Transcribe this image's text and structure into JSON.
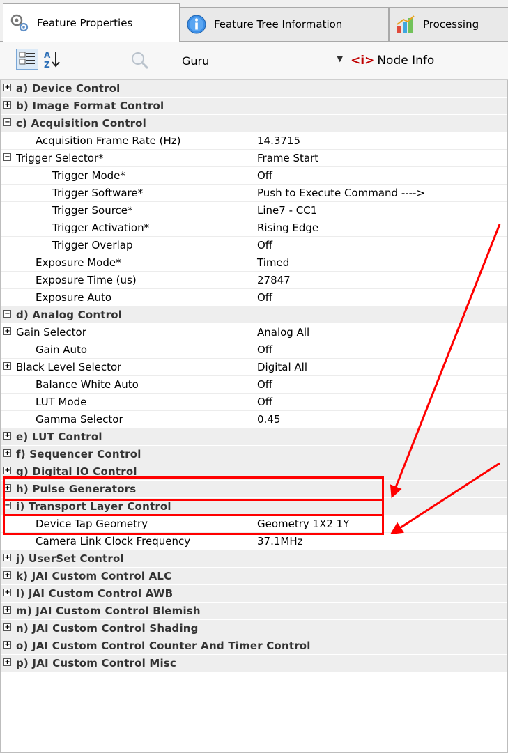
{
  "tabs": [
    {
      "label": "Feature Properties",
      "icon": "gear-icon",
      "active": true
    },
    {
      "label": "Feature Tree Information",
      "icon": "info-icon",
      "active": false
    },
    {
      "label": "Processing",
      "icon": "chart-icon",
      "active": false
    }
  ],
  "toolbar": {
    "visibility": "Guru",
    "node_info": "Node Info",
    "node_info_icon": "<i>"
  },
  "rows": [
    {
      "kind": "cat",
      "toggle": "+",
      "name": "a) Device Control",
      "level": 0
    },
    {
      "kind": "cat",
      "toggle": "+",
      "name": "b) Image Format Control",
      "level": 0
    },
    {
      "kind": "cat",
      "toggle": "-",
      "name": "c) Acquisition Control",
      "level": 0
    },
    {
      "kind": "prop",
      "name": "Acquisition Frame Rate (Hz)",
      "value": "14.3715",
      "level": 1
    },
    {
      "kind": "prop",
      "toggle": "-",
      "name": "Trigger Selector*",
      "value": "Frame Start",
      "level": 0
    },
    {
      "kind": "prop",
      "name": "Trigger Mode*",
      "value": "Off",
      "level": 2
    },
    {
      "kind": "prop",
      "name": "Trigger Software*",
      "value": "Push to Execute Command ---->",
      "level": 2
    },
    {
      "kind": "prop",
      "name": "Trigger Source*",
      "value": "Line7 - CC1",
      "level": 2
    },
    {
      "kind": "prop",
      "name": "Trigger Activation*",
      "value": "Rising Edge",
      "level": 2
    },
    {
      "kind": "prop",
      "name": "Trigger Overlap",
      "value": "Off",
      "level": 2
    },
    {
      "kind": "prop",
      "name": "Exposure Mode*",
      "value": "Timed",
      "level": 1
    },
    {
      "kind": "prop",
      "name": "Exposure Time (us)",
      "value": "27847",
      "level": 1
    },
    {
      "kind": "prop",
      "name": "Exposure Auto",
      "value": "Off",
      "level": 1
    },
    {
      "kind": "cat",
      "toggle": "-",
      "name": "d) Analog Control",
      "level": 0
    },
    {
      "kind": "prop",
      "toggle": "+",
      "name": "Gain Selector",
      "value": "Analog All",
      "level": 0
    },
    {
      "kind": "prop",
      "name": "Gain Auto",
      "value": "Off",
      "level": 1
    },
    {
      "kind": "prop",
      "toggle": "+",
      "name": "Black Level Selector",
      "value": "Digital All",
      "level": 0
    },
    {
      "kind": "prop",
      "name": "Balance White Auto",
      "value": "Off",
      "level": 1
    },
    {
      "kind": "prop",
      "name": "LUT Mode",
      "value": "Off",
      "level": 1
    },
    {
      "kind": "prop",
      "name": "Gamma Selector",
      "value": "0.45",
      "level": 1
    },
    {
      "kind": "cat",
      "toggle": "+",
      "name": "e) LUT Control",
      "level": 0
    },
    {
      "kind": "cat",
      "toggle": "+",
      "name": "f) Sequencer Control",
      "level": 0
    },
    {
      "kind": "cat",
      "toggle": "+",
      "name": "g) Digital IO Control",
      "level": 0
    },
    {
      "kind": "cat",
      "toggle": "+",
      "name": "h) Pulse Generators",
      "level": 0
    },
    {
      "kind": "cat",
      "toggle": "-",
      "name": "i) Transport Layer Control",
      "level": 0
    },
    {
      "kind": "prop",
      "name": "Device Tap Geometry",
      "value": "Geometry 1X2 1Y",
      "level": 1
    },
    {
      "kind": "prop",
      "name": "Camera Link Clock Frequency",
      "value": "37.1MHz",
      "level": 1
    },
    {
      "kind": "cat",
      "toggle": "+",
      "name": "j) UserSet Control",
      "level": 0
    },
    {
      "kind": "cat",
      "toggle": "+",
      "name": "k) JAI Custom Control ALC",
      "level": 0
    },
    {
      "kind": "cat",
      "toggle": "+",
      "name": "l) JAI Custom Control AWB",
      "level": 0
    },
    {
      "kind": "cat",
      "toggle": "+",
      "name": "m) JAI Custom Control Blemish",
      "level": 0
    },
    {
      "kind": "cat",
      "toggle": "+",
      "name": "n) JAI Custom Control Shading",
      "level": 0
    },
    {
      "kind": "cat",
      "toggle": "+",
      "name": "o) JAI Custom Control Counter And Timer Control",
      "level": 0
    },
    {
      "kind": "cat",
      "toggle": "+",
      "name": "p) JAI Custom Control Misc",
      "level": 0
    }
  ],
  "colors": {
    "annotation": "#ff0000",
    "category_bg": "#eeeeee",
    "selection_border": "#7aa7d6"
  }
}
